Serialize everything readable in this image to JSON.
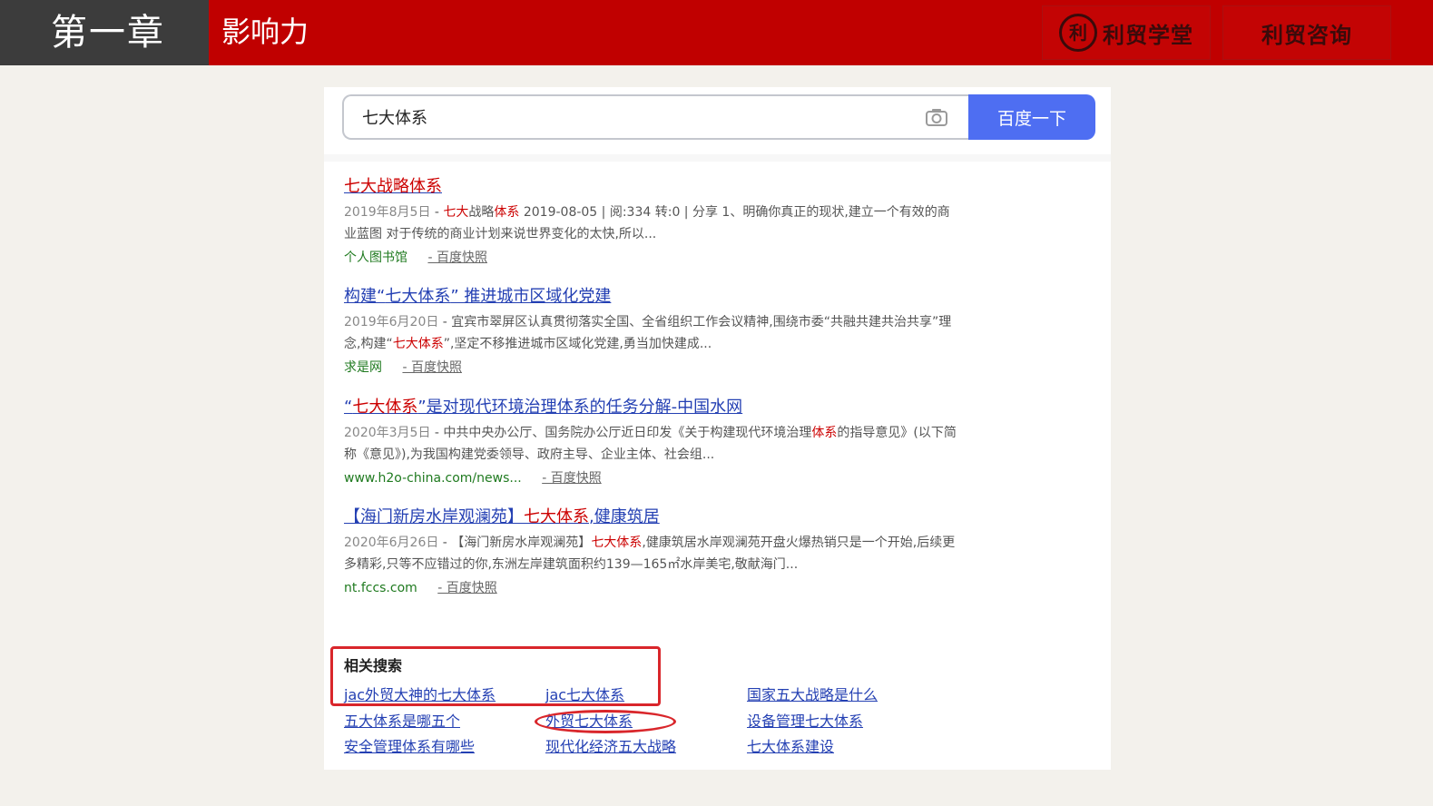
{
  "slide": {
    "chapter": "第一章",
    "section_title": "影响力",
    "logo1_seal": "利",
    "logo1_text": "利贸学堂",
    "logo2_text": "利贸咨询"
  },
  "search": {
    "query": "七大体系",
    "button_label": "百度一下"
  },
  "results": [
    {
      "title_pre": "",
      "title_hl": "七大战略体系",
      "title_post": "",
      "date": "2019年8月5日",
      "desc_pre": " - ",
      "desc_hl": "七大",
      "desc_mid": "战略",
      "desc_hl2": "体系",
      "desc_post": " 2019-08-05 | 阅:334 转:0 | 分享 1、明确你真正的现状,建立一个有效的商业蓝图 对于传统的商业计划来说世界变化的太快,所以...",
      "site": "个人图书馆",
      "cache": "- 百度快照"
    },
    {
      "title_pre": "构建“",
      "title_hl": "七大体系",
      "title_post": "” 推进城市区域化党建",
      "date": "2019年6月20日",
      "desc_pre": " - 宜宾市翠屏区认真贯彻落实全国、全省组织工作会议精神,围绕市委“共融共建共治共享”理念,构建“",
      "desc_hl": "七大体系",
      "desc_mid": "",
      "desc_hl2": "",
      "desc_post": "”,坚定不移推进城市区域化党建,勇当加快建成...",
      "site": "求是网",
      "cache": "- 百度快照"
    },
    {
      "title_pre": "“",
      "title_hl": "七大体系",
      "title_post": "”是对现代环境治理体系的任务分解-中国水网",
      "date": "2020年3月5日",
      "desc_pre": " - 中共中央办公厅、国务院办公厅近日印发《关于构建现代环境治理",
      "desc_hl": "体系",
      "desc_mid": "",
      "desc_hl2": "",
      "desc_post": "的指导意见》(以下简称《意见》),为我国构建党委领导、政府主导、企业主体、社会组...",
      "site": "www.h2o-china.com/news...",
      "cache": "- 百度快照"
    },
    {
      "title_pre": "【海门新房水岸观澜苑】",
      "title_hl": "七大体系",
      "title_post": ",健康筑居",
      "date": "2020年6月26日",
      "desc_pre": " - 【海门新房水岸观澜苑】",
      "desc_hl": "七大体系",
      "desc_mid": "",
      "desc_hl2": "",
      "desc_post": ",健康筑居水岸观澜苑开盘火爆热销只是一个开始,后续更多精彩,只等不应错过的你,东洲左岸建筑面积约139—165㎡水岸美宅,敬献海门...",
      "site": "nt.fccs.com",
      "cache": "- 百度快照"
    }
  ],
  "related": {
    "title": "相关搜索",
    "links": [
      "jac外贸大神的七大体系",
      "jac七大体系",
      "国家五大战略是什么",
      "五大体系是哪五个",
      "外贸七大体系",
      "设备管理七大体系",
      "安全管理体系有哪些",
      "现代化经济五大战略",
      "七大体系建设"
    ]
  },
  "colors": {
    "banner": "#c00000",
    "chapter_bg": "#3c3c3c",
    "link": "#2440b3",
    "highlight": "#c00",
    "annotation": "#d9262b",
    "button": "#4e6ef2"
  }
}
